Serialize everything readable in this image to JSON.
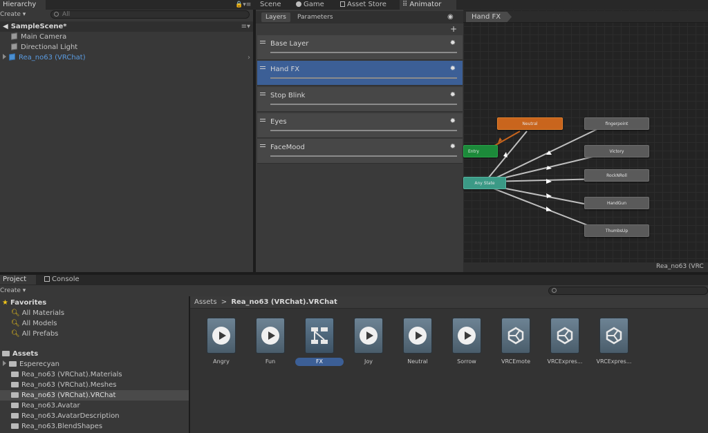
{
  "hierarchy": {
    "tab": "Hierarchy",
    "create": "Create",
    "search_placeholder": "All",
    "scene": "SampleScene*",
    "items": [
      {
        "label": "Main Camera"
      },
      {
        "label": "Directional Light"
      },
      {
        "label": "Rea_no63 (VRChat)"
      }
    ]
  },
  "top_tabs": {
    "scene": "Scene",
    "game": "Game",
    "asset_store": "Asset Store",
    "animator": "Animator"
  },
  "animator": {
    "tab_layers": "Layers",
    "tab_parameters": "Parameters",
    "add": "+",
    "breadcrumb": "Hand FX",
    "footer": "Rea_no63 (VRC",
    "layers": [
      {
        "name": "Base Layer"
      },
      {
        "name": "Hand FX"
      },
      {
        "name": "Stop Blink"
      },
      {
        "name": "Eyes"
      },
      {
        "name": "FaceMood"
      }
    ],
    "states": {
      "neutral": "Neutral",
      "entry": "Entry",
      "any_state": "Any State",
      "fingerpoint": "fingerpoint",
      "victory": "Victory",
      "rocknroll": "RockNRoll",
      "handgun": "HandGun",
      "thumbsup": "ThumbsUp"
    },
    "colors": {
      "orange": "#c9651d",
      "green": "#1c8a3a",
      "teal": "#3b9a86",
      "gray": "#5a5a5a"
    }
  },
  "project": {
    "tab_project": "Project",
    "tab_console": "Console",
    "create": "Create",
    "favorites": "Favorites",
    "favorites_items": [
      {
        "label": "All Materials"
      },
      {
        "label": "All Models"
      },
      {
        "label": "All Prefabs"
      }
    ],
    "assets": "Assets",
    "asset_folders": [
      {
        "label": "Esperecyan"
      },
      {
        "label": "Rea_no63 (VRChat).Materials"
      },
      {
        "label": "Rea_no63 (VRChat).Meshes"
      },
      {
        "label": "Rea_no63 (VRChat).VRChat"
      },
      {
        "label": "Rea_no63.Avatar"
      },
      {
        "label": "Rea_no63.AvatarDescription"
      },
      {
        "label": "Rea_no63.BlendShapes"
      }
    ],
    "breadcrumb_root": "Assets",
    "breadcrumb_sep": ">",
    "breadcrumb_current": "Rea_no63 (VRChat).VRChat",
    "grid_items": [
      {
        "label": "Angry",
        "icon": "animation-clip-icon"
      },
      {
        "label": "Fun",
        "icon": "animation-clip-icon"
      },
      {
        "label": "FX",
        "icon": "animator-controller-icon"
      },
      {
        "label": "Joy",
        "icon": "animation-clip-icon"
      },
      {
        "label": "Neutral",
        "icon": "animation-clip-icon"
      },
      {
        "label": "Sorrow",
        "icon": "animation-clip-icon"
      },
      {
        "label": "VRCEmote",
        "icon": "unity-logo-icon"
      },
      {
        "label": "VRCExpres...",
        "icon": "unity-logo-icon"
      },
      {
        "label": "VRCExpres...",
        "icon": "unity-logo-icon"
      }
    ]
  }
}
